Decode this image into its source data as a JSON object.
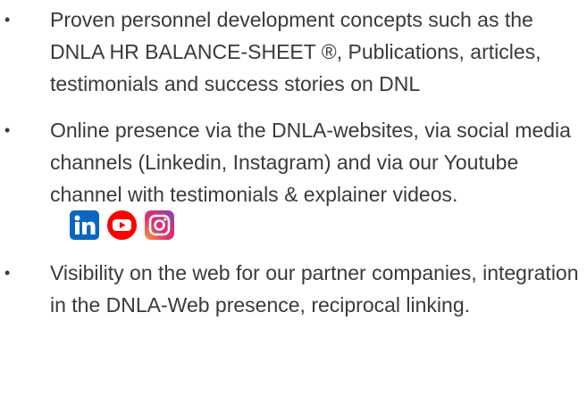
{
  "bullets": [
    {
      "text": "Proven personnel development concepts such as the DNLA HR BALANCE-SHEET ®, Publications, articles, testimonials and success stories on DNL"
    },
    {
      "text": "Online presence via the DNLA-websites, via social media channels (Linkedin, Instagram) and via our Youtube channel with testimonials  & explainer videos."
    },
    {
      "text": "Visibility on the web for our partner companies, integration in the DNLA-Web presence, reciprocal linking."
    }
  ],
  "bullet_symbol": "•",
  "social_icons": [
    {
      "name": "linkedin-icon",
      "color": "#0a66c2"
    },
    {
      "name": "youtube-icon",
      "color": "#ff0000"
    },
    {
      "name": "instagram-icon",
      "color": "#c13584"
    }
  ]
}
